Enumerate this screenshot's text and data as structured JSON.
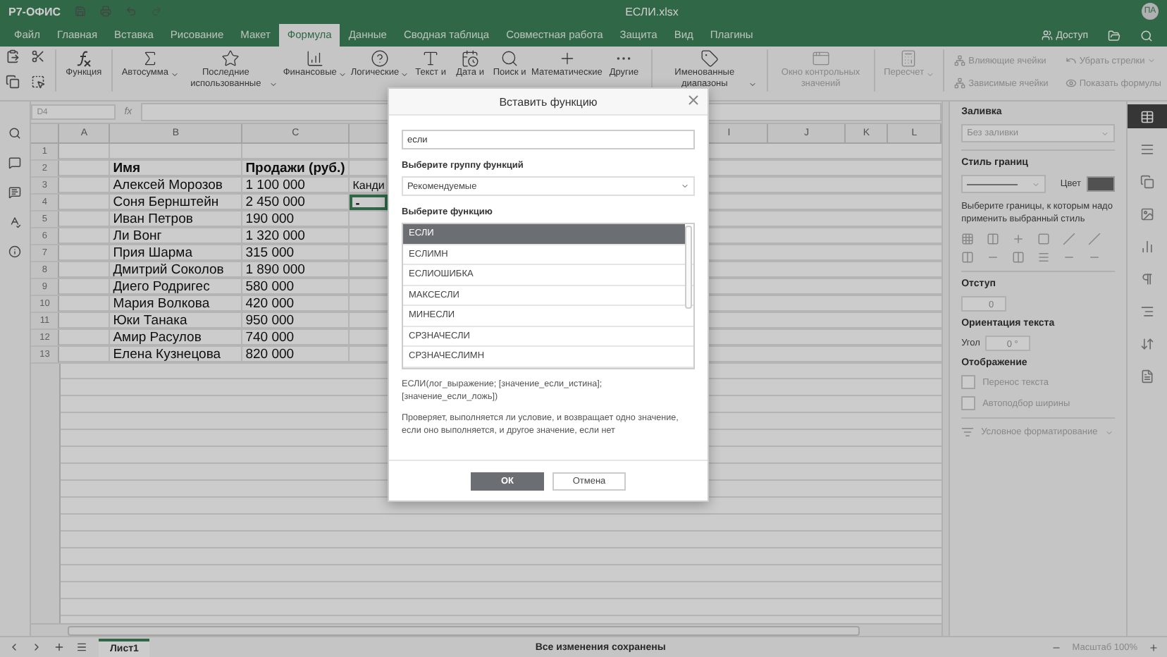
{
  "app": {
    "logo": "Р7-ОФИС",
    "file_title": "ЕСЛИ.xlsx",
    "avatar": "ПА",
    "share": "Доступ"
  },
  "menu_tabs": [
    {
      "label": "Файл",
      "selected": false
    },
    {
      "label": "Главная",
      "selected": false
    },
    {
      "label": "Вставка",
      "selected": false
    },
    {
      "label": "Рисование",
      "selected": false
    },
    {
      "label": "Макет",
      "selected": false
    },
    {
      "label": "Формула",
      "selected": true
    },
    {
      "label": "Данные",
      "selected": false
    },
    {
      "label": "Сводная таблица",
      "selected": false
    },
    {
      "label": "Совместная работа",
      "selected": false
    },
    {
      "label": "Защита",
      "selected": false
    },
    {
      "label": "Вид",
      "selected": false
    },
    {
      "label": "Плагины",
      "selected": false
    }
  ],
  "toolbar": {
    "large": [
      {
        "label": "Функция",
        "caret": false,
        "disabled": false
      },
      {
        "label": "Автосумма",
        "caret": true,
        "disabled": false
      },
      {
        "label": "Последние использованные",
        "caret": true,
        "disabled": false
      },
      {
        "label": "Финансовые",
        "caret": true,
        "disabled": false
      },
      {
        "label": "Логические",
        "caret": true,
        "disabled": false
      },
      {
        "label": "Текст и",
        "caret": false,
        "disabled": false
      },
      {
        "label": "Дата и",
        "caret": false,
        "disabled": false
      },
      {
        "label": "Поиск и",
        "caret": false,
        "disabled": false
      },
      {
        "label": "Математические",
        "caret": false,
        "disabled": false
      },
      {
        "label": "Другие",
        "caret": false,
        "disabled": false
      },
      {
        "label": "Именованные диапазоны",
        "caret": true,
        "disabled": false
      },
      {
        "label": "Окно контрольных значений",
        "caret": false,
        "disabled": true
      },
      {
        "label": "Пересчет",
        "caret": true,
        "disabled": true
      }
    ],
    "small": [
      {
        "label": "Влияющие ячейки",
        "caret": false,
        "disabled": true
      },
      {
        "label": "Убрать стрелки",
        "caret": true,
        "disabled": true
      },
      {
        "label": "Зависимые ячейки",
        "caret": false,
        "disabled": true
      },
      {
        "label": "Показать формулы",
        "caret": false,
        "disabled": true
      }
    ]
  },
  "formula_bar": {
    "cell_ref": "D4",
    "fx_label": "fx"
  },
  "sheet": {
    "columns": [
      "A",
      "B",
      "C",
      "I",
      "J",
      "K",
      "L"
    ],
    "rows": [
      {
        "number": "1",
        "kind": "data"
      },
      {
        "number": "2",
        "kind": "header",
        "name": "Имя",
        "sales": "Продажи (руб.)"
      },
      {
        "number": "3",
        "kind": "data",
        "name": "Алексей Морозов",
        "sales": "1 100 000",
        "extra": "Канди"
      },
      {
        "number": "4",
        "kind": "data",
        "name": "Соня Бернштейн",
        "sales": "2 450 000",
        "extra": "-",
        "active": true
      },
      {
        "number": "5",
        "kind": "data",
        "name": "Иван Петров",
        "sales": "190 000"
      },
      {
        "number": "6",
        "kind": "data",
        "name": "Ли Вонг",
        "sales": "1 320 000"
      },
      {
        "number": "7",
        "kind": "data",
        "name": "Прия Шарма",
        "sales": "315 000"
      },
      {
        "number": "8",
        "kind": "data",
        "name": "Дмитрий Соколов",
        "sales": "1 890 000"
      },
      {
        "number": "9",
        "kind": "data",
        "name": "Диего Родригес",
        "sales": "580 000"
      },
      {
        "number": "10",
        "kind": "data",
        "name": "Мария Волкова",
        "sales": "420 000"
      },
      {
        "number": "11",
        "kind": "data",
        "name": "Юки Танака",
        "sales": "950 000"
      },
      {
        "number": "12",
        "kind": "data",
        "name": "Амир Расулов",
        "sales": "740 000"
      },
      {
        "number": "13",
        "kind": "data",
        "name": "Елена Кузнецова",
        "sales": "820 000"
      }
    ]
  },
  "right_panel": {
    "fill_title": "Заливка",
    "fill_value": "Без заливки",
    "border_title": "Стиль границ",
    "color_label": "Цвет",
    "border_hint": "Выберите границы, к которым надо применить выбранный стиль",
    "indent_title": "Отступ",
    "indent_value": "0",
    "orientation_title": "Ориентация текста",
    "angle_label": "Угол",
    "angle_value": "0 °",
    "display_title": "Отображение",
    "checkboxes": [
      {
        "label": "Перенос текста",
        "checked": false
      },
      {
        "label": "Автоподбор ширины",
        "checked": false
      }
    ],
    "conditional": "Условное форматирование"
  },
  "right_tabs": [
    {
      "selected": true
    },
    {
      "selected": false
    },
    {
      "selected": false
    },
    {
      "selected": false
    },
    {
      "selected": false
    },
    {
      "selected": false
    },
    {
      "selected": false
    },
    {
      "selected": false
    },
    {
      "selected": false
    }
  ],
  "status_bar": {
    "sheet_tab": "Лист1",
    "message": "Все изменения сохранены",
    "zoom": "Масштаб 100%"
  },
  "dialog": {
    "title": "Вставить функцию",
    "search_value": "если",
    "group_label": "Выберите группу функций",
    "group_value": "Рекомендуемые",
    "function_label": "Выберите функцию",
    "functions": [
      {
        "name": "ЕСЛИ",
        "selected": true
      },
      {
        "name": "ЕСЛИМН",
        "selected": false
      },
      {
        "name": "ЕСЛИОШИБКА",
        "selected": false
      },
      {
        "name": "МАКСЕСЛИ",
        "selected": false
      },
      {
        "name": "МИНЕСЛИ",
        "selected": false
      },
      {
        "name": "СРЗНАЧЕСЛИ",
        "selected": false
      },
      {
        "name": "СРЗНАЧЕСЛИМН",
        "selected": false
      }
    ],
    "syntax": "ЕСЛИ(лог_выражение; [значение_если_истина]; [значение_если_ложь])",
    "description": "Проверяет, выполняется ли условие, и возвращает одно значение, если оно выполняется, и другое значение, если нет",
    "ok": "ОК",
    "cancel": "Отмена"
  }
}
